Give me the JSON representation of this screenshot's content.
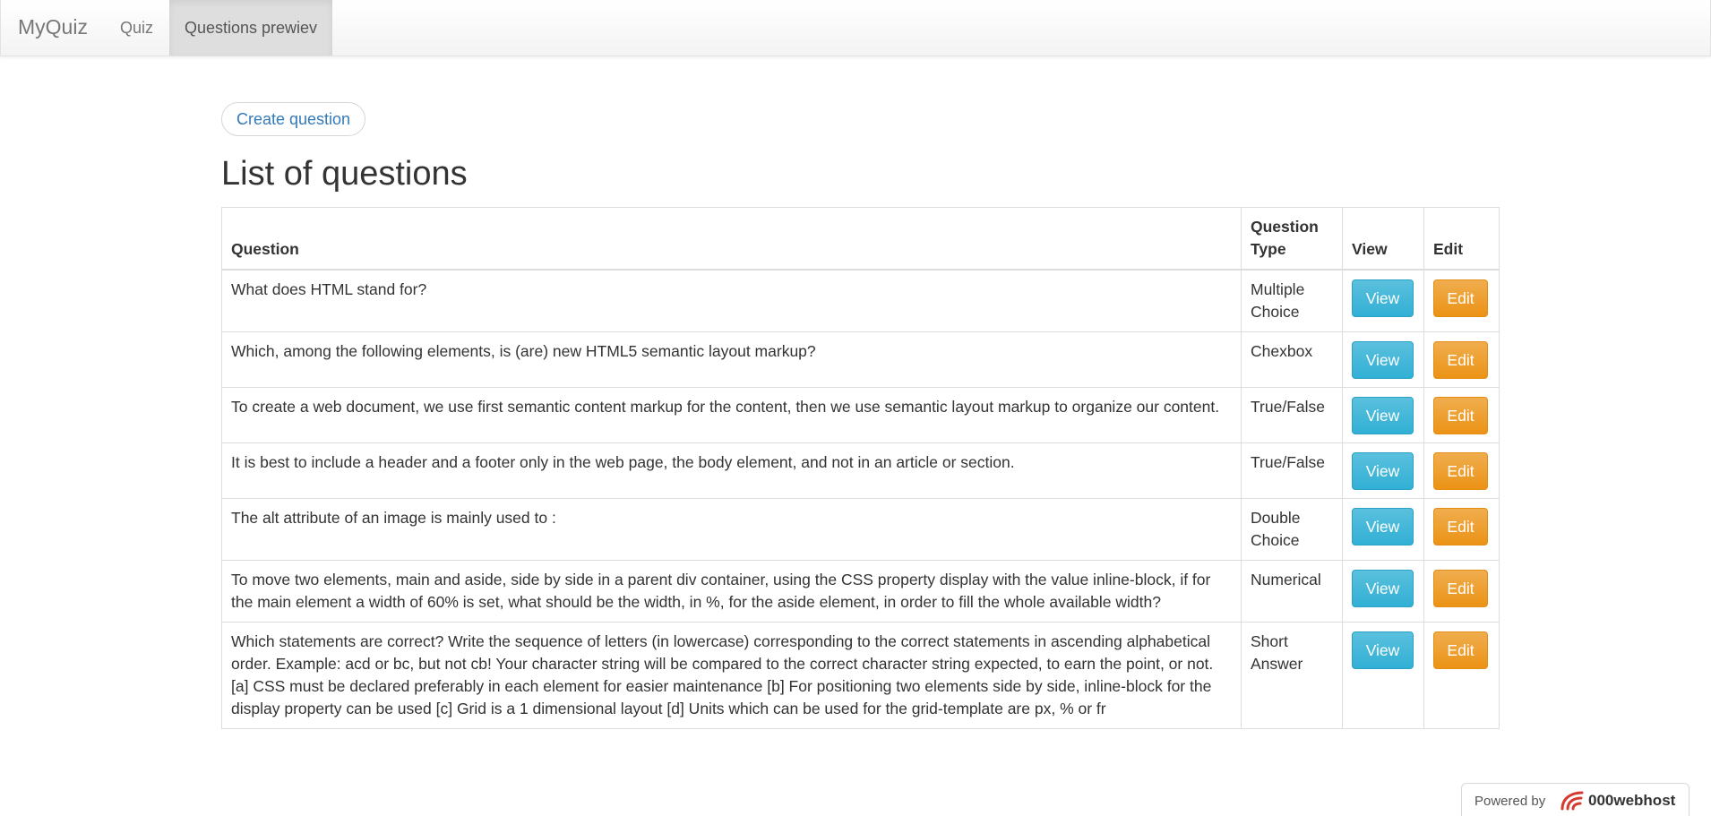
{
  "navbar": {
    "brand": "MyQuiz",
    "items": [
      {
        "label": "Quiz",
        "active": false
      },
      {
        "label": "Questions prewiev",
        "active": true
      }
    ]
  },
  "create_button": "Create question",
  "title": "List of questions",
  "table": {
    "headers": [
      "Question",
      "Question Type",
      "View",
      "Edit"
    ],
    "rows": [
      {
        "question": "What does HTML stand for?",
        "type": "Multiple Choice",
        "view": "View",
        "edit": "Edit"
      },
      {
        "question": "Which, among the following elements, is (are) new HTML5 semantic layout markup?",
        "type": "Chexbox",
        "view": "View",
        "edit": "Edit"
      },
      {
        "question": "To create a web document, we use first semantic content markup for the content, then we use semantic layout markup to organize our content.",
        "type": "True/False",
        "view": "View",
        "edit": "Edit"
      },
      {
        "question": "It is best to include a header and a footer only in the web page, the body element, and not in an article or section.",
        "type": "True/False",
        "view": "View",
        "edit": "Edit"
      },
      {
        "question": "The alt attribute of an image is mainly used to :",
        "type": "Double Choice",
        "view": "View",
        "edit": "Edit"
      },
      {
        "question": "To move two elements, main and aside, side by side in a parent div container, using the CSS property display with the value inline-block, if for the main element a width of 60% is set, what should be the width, in %, for the aside element, in order to fill the whole available width?",
        "type": "Numerical",
        "view": "View",
        "edit": "Edit"
      },
      {
        "question": "Which statements are correct? Write the sequence of letters (in lowercase) corresponding to the correct statements in ascending alphabetical order. Example: acd or bc, but not cb! Your character string will be compared to the correct character string expected, to earn the point, or not. [a] CSS must be declared preferably in each element for easier maintenance [b] For positioning two elements side by side, inline-block for the display property can be used [c] Grid is a 1 dimensional layout [d] Units which can be used for the grid-template are px, % or fr",
        "type": "Short Answer",
        "view": "View",
        "edit": "Edit"
      }
    ]
  },
  "footer": {
    "powered_by": "Powered by",
    "host": "000webhost",
    "logo_icon": "000webhost-logo-icon"
  },
  "colors": {
    "view_button": "#31b0d5",
    "edit_button": "#eb9316",
    "link": "#337ab7"
  }
}
